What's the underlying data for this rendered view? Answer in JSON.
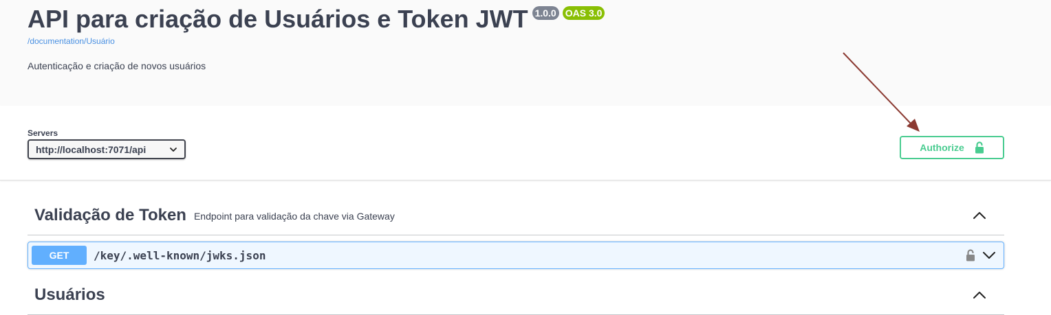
{
  "info": {
    "title": "API para criação de Usuários e Token JWT",
    "version_badge": "1.0.0",
    "oas_badge": "OAS 3.0",
    "doc_link": "/documentation/Usuário",
    "description": "Autenticação e criação de novos usuários"
  },
  "servers": {
    "label": "Servers",
    "selected": "http://localhost:7071/api"
  },
  "authorize": {
    "label": "Authorize",
    "icon": "unlock-icon"
  },
  "tags": [
    {
      "name": "Validação de Token",
      "description": "Endpoint para validação da chave via Gateway",
      "expanded": true,
      "operations": [
        {
          "method": "GET",
          "path": "/key/.well-known/jwks.json"
        }
      ]
    },
    {
      "name": "Usuários",
      "description": "",
      "expanded": true
    }
  ],
  "colors": {
    "authorize": "#49cc90",
    "get": "#61affe",
    "version_badge": "#7d8492",
    "oas_badge": "#89bf04",
    "annotation_arrow": "#8b3a32"
  }
}
